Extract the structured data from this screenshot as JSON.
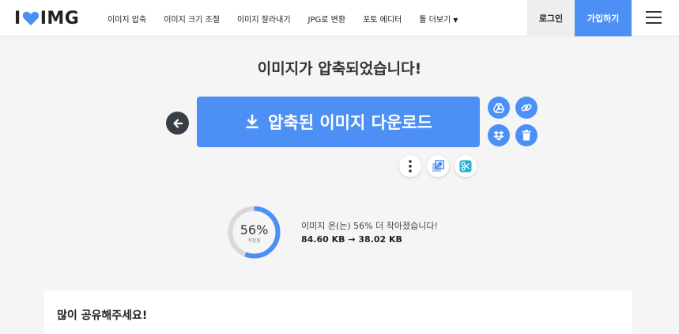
{
  "header": {
    "logo_left": "I",
    "logo_right": "IMG",
    "nav": [
      "이미지 압축",
      "이미지 크기 조절",
      "이미지 잘라내기",
      "JPG로 변환",
      "포토 에디터",
      "툴 더보기"
    ],
    "login_label": "로그인",
    "signup_label": "가입하기"
  },
  "main": {
    "headline": "이미지가 압축되었습니다!",
    "download_label": "압축된 이미지 다운로드"
  },
  "result": {
    "percent_label": "56%",
    "percent_value": 56,
    "saved_label": "저장됨",
    "message": "이미지 온(는) 56% 더 작아졌습니다!",
    "sizes": "84.60 KB → 38.02 KB"
  },
  "share": {
    "title": "많이 공유해주세요!"
  },
  "colors": {
    "accent": "#4d90f5",
    "dark": "#383e45",
    "background": "#f5f5f5",
    "ring_track": "#d9d9d9"
  }
}
